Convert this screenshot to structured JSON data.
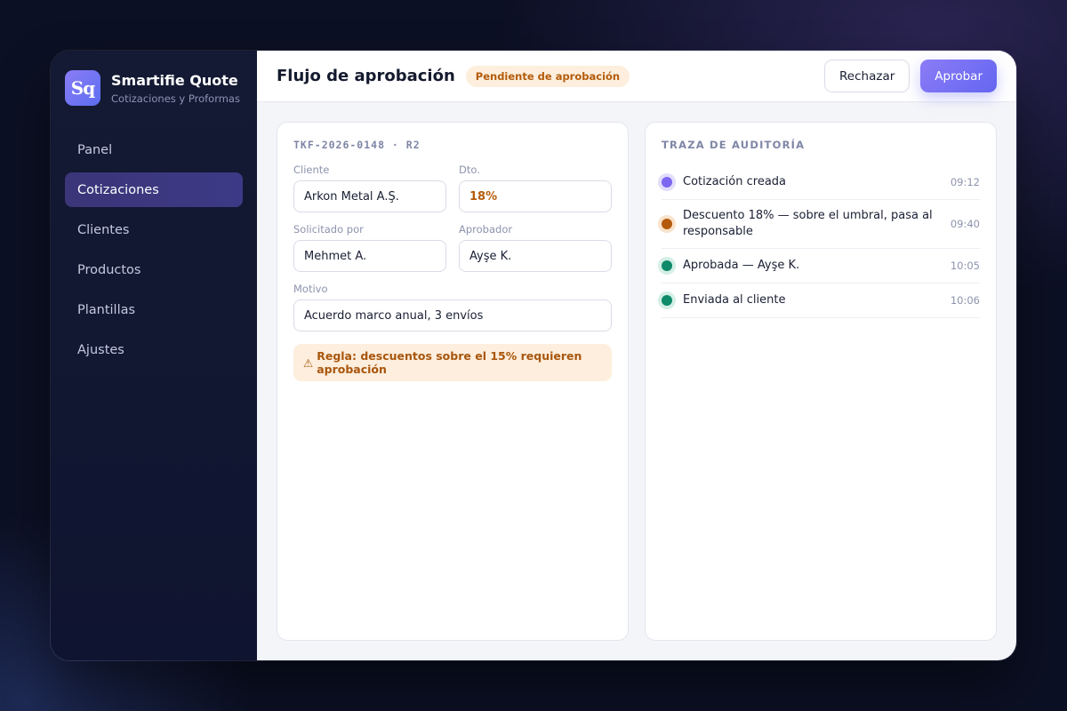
{
  "brand": {
    "logo_text": "Sq",
    "title": "Smartifie Quote",
    "subtitle": "Cotizaciones y Proformas"
  },
  "sidebar": {
    "items": [
      {
        "label": "Panel",
        "active": false
      },
      {
        "label": "Cotizaciones",
        "active": true
      },
      {
        "label": "Clientes",
        "active": false
      },
      {
        "label": "Productos",
        "active": false
      },
      {
        "label": "Plantillas",
        "active": false
      },
      {
        "label": "Ajustes",
        "active": false
      }
    ]
  },
  "header": {
    "title": "Flujo de aprobación",
    "status": "Pendiente de aprobación",
    "reject_label": "Rechazar",
    "approve_label": "Aprobar"
  },
  "quote": {
    "ref": "TKF-2026-0148 · R2",
    "client_label": "Cliente",
    "client": "Arkon Metal A.Ş.",
    "discount_label": "Dto.",
    "discount": "18%",
    "requested_by_label": "Solicitado por",
    "requested_by": "Mehmet A.",
    "approver_label": "Aprobador",
    "approver": "Ayşe K.",
    "reason_label": "Motivo",
    "reason": "Acuerdo marco anual, 3 envíos",
    "rule_icon": "⚠",
    "rule": "Regla: descuentos sobre el 15% requieren aprobación"
  },
  "audit": {
    "title": "TRAZA DE AUDITORÍA",
    "events": [
      {
        "text": "Cotización creada",
        "time": "09:12",
        "color": "#7c66f0",
        "ring": "#e3ddfc"
      },
      {
        "text": "Descuento 18% — sobre el umbral, pasa al responsable",
        "time": "09:40",
        "color": "#b35b0b",
        "ring": "#fae3cc"
      },
      {
        "text": "Aprobada — Ayşe K.",
        "time": "10:05",
        "color": "#0f8a6a",
        "ring": "#d4efe6"
      },
      {
        "text": "Enviada al cliente",
        "time": "10:06",
        "color": "#0f8a6a",
        "ring": "#d4efe6"
      }
    ]
  },
  "colors": {
    "accent": "#6466f1",
    "warning": "#b35b0b",
    "success": "#0f8a6a"
  }
}
